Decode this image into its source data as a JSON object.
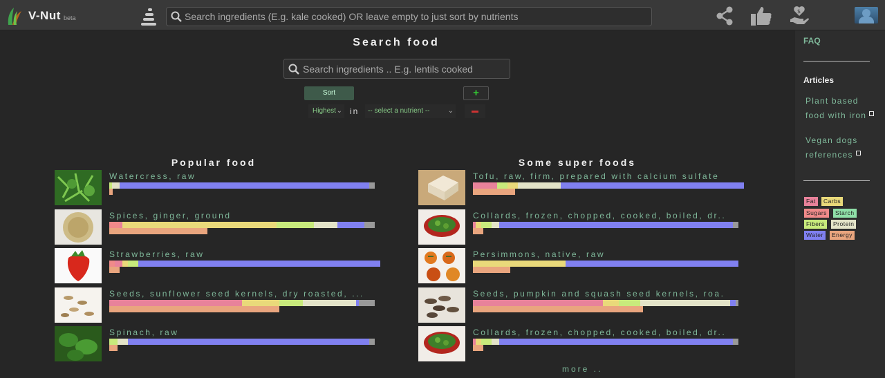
{
  "app": {
    "brand": "V-Nut",
    "beta": "beta"
  },
  "topbar": {
    "search_placeholder": "Search ingredients (E.g. kale cooked) OR leave empty to just sort by nutrients"
  },
  "main": {
    "title": "Search food",
    "search_placeholder": "Search ingredients .. E.g. lentils cooked",
    "sort_label": "Sort",
    "add_label": "+",
    "direction_value": "Highest",
    "in_label": "in",
    "nutrient_value": "-- select a nutrient --",
    "more_label": "more .."
  },
  "colors": {
    "fat": "#e8829a",
    "carbs": "#e9d97a",
    "sugars": "#f08a8a",
    "starch": "#8fe0a8",
    "fibers": "#c8ea7c",
    "protein": "#e3e3c8",
    "water": "#8080f0",
    "energy": "#e9a57e",
    "other": "#999999"
  },
  "popular": {
    "title": "Popular food",
    "items": [
      {
        "name": "Watercress, raw",
        "thumb": "greens",
        "bar": [
          [
            "fibers",
            0.01
          ],
          [
            "protein",
            0.03
          ],
          [
            "water",
            0.94
          ]
        ],
        "energy": 0.014
      },
      {
        "name": "Spices, ginger, ground",
        "thumb": "powder",
        "bar": [
          [
            "sugars",
            0.04
          ],
          [
            "fat",
            0.01
          ],
          [
            "carbs",
            0.58
          ],
          [
            "fibers",
            0.14
          ],
          [
            "protein",
            0.09
          ],
          [
            "water",
            0.1
          ]
        ],
        "energy": 0.37
      },
      {
        "name": "Strawberries, raw",
        "thumb": "strawberry",
        "bar": [
          [
            "sugars",
            0.02
          ],
          [
            "fat",
            0.03
          ],
          [
            "carbs",
            0.02
          ],
          [
            "fibers",
            0.04
          ],
          [
            "water",
            0.91
          ]
        ],
        "energy": 0.04
      },
      {
        "name": "Seeds, sunflower seed kernels, dry roasted, ...",
        "thumb": "seeds",
        "bar": [
          [
            "fat",
            0.5
          ],
          [
            "carbs",
            0.14
          ],
          [
            "fibers",
            0.09
          ],
          [
            "protein",
            0.2
          ],
          [
            "water",
            0.01
          ]
        ],
        "energy": 0.64
      },
      {
        "name": "Spinach, raw",
        "thumb": "spinach",
        "bar": [
          [
            "fibers",
            0.03
          ],
          [
            "protein",
            0.04
          ],
          [
            "water",
            0.91
          ]
        ],
        "energy": 0.03
      }
    ]
  },
  "super": {
    "title": "Some super foods",
    "items": [
      {
        "name": "Tofu, raw, firm, prepared with calcium sulfate",
        "thumb": "tofu",
        "bar": [
          [
            "fat",
            0.09
          ],
          [
            "fibers",
            0.04
          ],
          [
            "carbs",
            0.04
          ],
          [
            "protein",
            0.16
          ],
          [
            "water",
            0.69
          ]
        ],
        "energy": 0.16
      },
      {
        "name": "Collards, frozen, chopped, cooked, boiled, dr...",
        "thumb": "bowl",
        "bar": [
          [
            "fat",
            0.01
          ],
          [
            "carbs",
            0.02
          ],
          [
            "fibers",
            0.04
          ],
          [
            "protein",
            0.03
          ],
          [
            "water",
            0.88
          ]
        ],
        "energy": 0.04
      },
      {
        "name": "Persimmons, native, raw",
        "thumb": "persimmon",
        "bar": [
          [
            "carbs",
            0.35
          ],
          [
            "water",
            0.65
          ]
        ],
        "energy": 0.14
      },
      {
        "name": "Seeds, pumpkin and squash seed kernels, roa...",
        "thumb": "pumpkinseeds",
        "bar": [
          [
            "fat",
            0.49
          ],
          [
            "carbs",
            0.06
          ],
          [
            "fibers",
            0.08
          ],
          [
            "protein",
            0.34
          ],
          [
            "water",
            0.02
          ]
        ],
        "energy": 0.64
      },
      {
        "name": "Collards, frozen, chopped, cooked, boiled, dr...",
        "thumb": "bowl",
        "bar": [
          [
            "fat",
            0.01
          ],
          [
            "carbs",
            0.02
          ],
          [
            "fibers",
            0.04
          ],
          [
            "protein",
            0.03
          ],
          [
            "water",
            0.88
          ]
        ],
        "energy": 0.04
      }
    ]
  },
  "sidebar": {
    "faq": "FAQ",
    "articles_heading": "Articles",
    "articles": [
      "Plant based food with iron",
      "Vegan dogs references"
    ],
    "legend": [
      {
        "label": "Fat",
        "color": "#e8829a"
      },
      {
        "label": "Carbs",
        "color": "#e9d97a"
      },
      {
        "label": "Sugars",
        "color": "#f08a8a"
      },
      {
        "label": "Starch",
        "color": "#8fe0a8"
      },
      {
        "label": "Fibers",
        "color": "#c8ea7c"
      },
      {
        "label": "Protein",
        "color": "#e3e3c8"
      },
      {
        "label": "Water",
        "color": "#8080f0"
      },
      {
        "label": "Energy",
        "color": "#e9a57e"
      }
    ]
  },
  "icons": [
    "leaf-logo-icon",
    "menu-icon",
    "search-icon",
    "share-icon",
    "thumbs-up-icon",
    "donate-icon",
    "avatar-icon",
    "external-link-icon"
  ]
}
